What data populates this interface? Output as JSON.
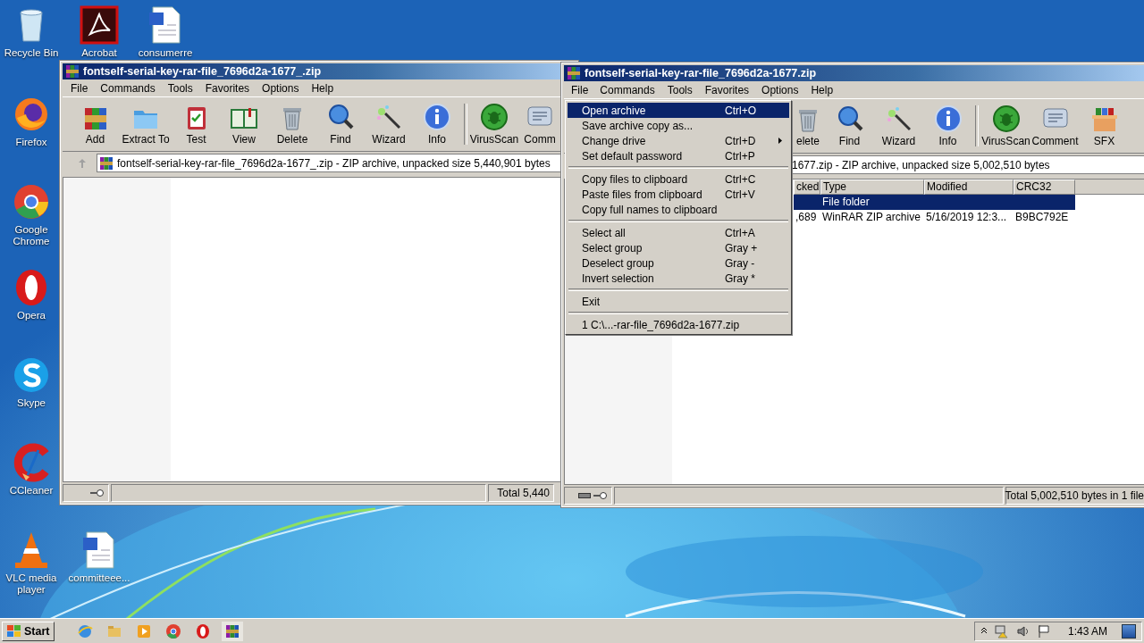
{
  "desktop_icons": [
    {
      "label": "Recycle Bin"
    },
    {
      "label": "Acrobat"
    },
    {
      "label": "consumerre"
    },
    {
      "label": "Firefox"
    },
    {
      "label": "Google Chrome"
    },
    {
      "label": "Opera"
    },
    {
      "label": "Skype"
    },
    {
      "label": "CCleaner"
    },
    {
      "label": "VLC media player"
    },
    {
      "label": "committeee..."
    }
  ],
  "windows": [
    {
      "title": "fontself-serial-key-rar-file_7696d2a-1677_.zip",
      "menu": [
        {
          "label": "File",
          "selected": false
        },
        {
          "label": "Commands",
          "selected": false
        },
        {
          "label": "Tools",
          "selected": false
        },
        {
          "label": "Favorites",
          "selected": false
        },
        {
          "label": "Options",
          "selected": false
        },
        {
          "label": "Help",
          "selected": false
        }
      ],
      "toolbar": [
        "Add",
        "Extract To",
        "Test",
        "View",
        "Delete",
        "Find",
        "Wizard",
        "Info",
        "VirusScan",
        "Comm"
      ],
      "address": "fontself-serial-key-rar-file_7696d2a-1677_.zip - ZIP archive, unpacked size 5,440,901 bytes",
      "status": "Total 5,440"
    },
    {
      "title": "fontself-serial-key-rar-file_7696d2a-1677.zip",
      "menu": [
        {
          "label": "File",
          "selected": true
        },
        {
          "label": "Commands",
          "selected": false
        },
        {
          "label": "Tools",
          "selected": false
        },
        {
          "label": "Favorites",
          "selected": false
        },
        {
          "label": "Options",
          "selected": false
        },
        {
          "label": "Help",
          "selected": false
        }
      ],
      "toolbar": [
        "elete",
        "Find",
        "Wizard",
        "Info",
        "VirusScan",
        "Comment",
        "SFX"
      ],
      "address": "1677.zip - ZIP archive, unpacked size 5,002,510 bytes",
      "columns": [
        "cked",
        "Type",
        "Modified",
        "CRC32"
      ],
      "rows": [
        {
          "selected": true,
          "type": "File folder"
        },
        {
          "selected": false,
          "column_1": ",689",
          "type": "WinRAR ZIP archive",
          "modified": "5/16/2019 12:3...",
          "crc32": "B9BC792E"
        }
      ],
      "status": "Total 5,002,510 bytes in 1 file"
    }
  ],
  "file_menu": [
    {
      "kind": "item",
      "label": "Open archive",
      "shortcut": "Ctrl+O",
      "selected": true,
      "submenu": false
    },
    {
      "kind": "item",
      "label": "Save archive copy as...",
      "selected": false,
      "submenu": false
    },
    {
      "kind": "item",
      "label": "Change drive",
      "shortcut": "Ctrl+D",
      "selected": false,
      "submenu": true
    },
    {
      "kind": "item",
      "label": "Set default password",
      "shortcut": "Ctrl+P",
      "selected": false,
      "submenu": false
    },
    {
      "kind": "separator"
    },
    {
      "kind": "item",
      "label": "Copy files to clipboard",
      "shortcut": "Ctrl+C",
      "selected": false,
      "submenu": false
    },
    {
      "kind": "item",
      "label": "Paste files from clipboard",
      "shortcut": "Ctrl+V",
      "selected": false,
      "submenu": false
    },
    {
      "kind": "item",
      "label": "Copy full names to clipboard",
      "selected": false,
      "submenu": false
    },
    {
      "kind": "separator"
    },
    {
      "kind": "item",
      "label": "Select all",
      "shortcut": "Ctrl+A",
      "selected": false,
      "submenu": false
    },
    {
      "kind": "item",
      "label": "Select group",
      "shortcut": "Gray +",
      "selected": false,
      "submenu": false
    },
    {
      "kind": "item",
      "label": "Deselect group",
      "shortcut": "Gray -",
      "selected": false,
      "submenu": false
    },
    {
      "kind": "item",
      "label": "Invert selection",
      "shortcut": "Gray *",
      "selected": false,
      "submenu": false
    },
    {
      "kind": "separator"
    },
    {
      "kind": "item",
      "label": "Exit",
      "selected": false,
      "submenu": false
    },
    {
      "kind": "separator"
    },
    {
      "kind": "item",
      "label": "1  C:\\...-rar-file_7696d2a-1677.zip",
      "selected": false,
      "submenu": false
    }
  ],
  "taskbar": {
    "start": "Start",
    "apps": [
      {
        "selected": false
      },
      {
        "selected": false
      },
      {
        "selected": false
      },
      {
        "selected": false
      },
      {
        "selected": false
      },
      {
        "selected": true
      }
    ],
    "clock": "1:43 AM"
  }
}
